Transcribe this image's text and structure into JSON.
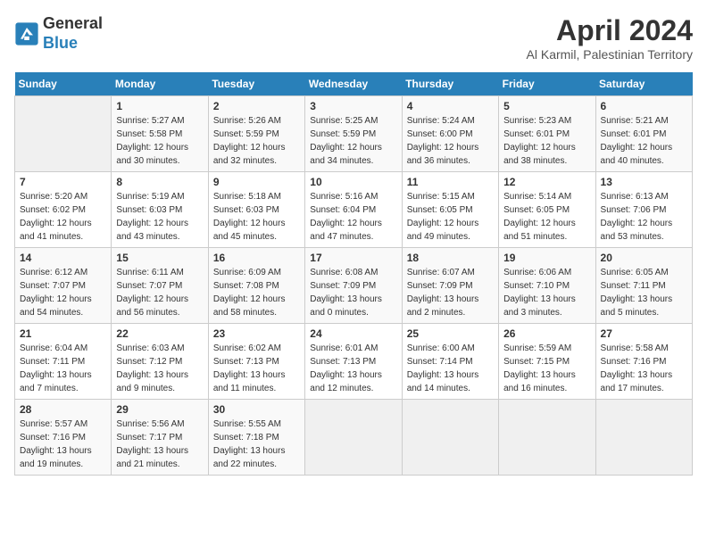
{
  "header": {
    "logo_line1": "General",
    "logo_line2": "Blue",
    "month": "April 2024",
    "location": "Al Karmil, Palestinian Territory"
  },
  "weekdays": [
    "Sunday",
    "Monday",
    "Tuesday",
    "Wednesday",
    "Thursday",
    "Friday",
    "Saturday"
  ],
  "weeks": [
    [
      {
        "day": "",
        "info": ""
      },
      {
        "day": "1",
        "info": "Sunrise: 5:27 AM\nSunset: 5:58 PM\nDaylight: 12 hours\nand 30 minutes."
      },
      {
        "day": "2",
        "info": "Sunrise: 5:26 AM\nSunset: 5:59 PM\nDaylight: 12 hours\nand 32 minutes."
      },
      {
        "day": "3",
        "info": "Sunrise: 5:25 AM\nSunset: 5:59 PM\nDaylight: 12 hours\nand 34 minutes."
      },
      {
        "day": "4",
        "info": "Sunrise: 5:24 AM\nSunset: 6:00 PM\nDaylight: 12 hours\nand 36 minutes."
      },
      {
        "day": "5",
        "info": "Sunrise: 5:23 AM\nSunset: 6:01 PM\nDaylight: 12 hours\nand 38 minutes."
      },
      {
        "day": "6",
        "info": "Sunrise: 5:21 AM\nSunset: 6:01 PM\nDaylight: 12 hours\nand 40 minutes."
      }
    ],
    [
      {
        "day": "7",
        "info": "Sunrise: 5:20 AM\nSunset: 6:02 PM\nDaylight: 12 hours\nand 41 minutes."
      },
      {
        "day": "8",
        "info": "Sunrise: 5:19 AM\nSunset: 6:03 PM\nDaylight: 12 hours\nand 43 minutes."
      },
      {
        "day": "9",
        "info": "Sunrise: 5:18 AM\nSunset: 6:03 PM\nDaylight: 12 hours\nand 45 minutes."
      },
      {
        "day": "10",
        "info": "Sunrise: 5:16 AM\nSunset: 6:04 PM\nDaylight: 12 hours\nand 47 minutes."
      },
      {
        "day": "11",
        "info": "Sunrise: 5:15 AM\nSunset: 6:05 PM\nDaylight: 12 hours\nand 49 minutes."
      },
      {
        "day": "12",
        "info": "Sunrise: 5:14 AM\nSunset: 6:05 PM\nDaylight: 12 hours\nand 51 minutes."
      },
      {
        "day": "13",
        "info": "Sunrise: 6:13 AM\nSunset: 7:06 PM\nDaylight: 12 hours\nand 53 minutes."
      }
    ],
    [
      {
        "day": "14",
        "info": "Sunrise: 6:12 AM\nSunset: 7:07 PM\nDaylight: 12 hours\nand 54 minutes."
      },
      {
        "day": "15",
        "info": "Sunrise: 6:11 AM\nSunset: 7:07 PM\nDaylight: 12 hours\nand 56 minutes."
      },
      {
        "day": "16",
        "info": "Sunrise: 6:09 AM\nSunset: 7:08 PM\nDaylight: 12 hours\nand 58 minutes."
      },
      {
        "day": "17",
        "info": "Sunrise: 6:08 AM\nSunset: 7:09 PM\nDaylight: 13 hours\nand 0 minutes."
      },
      {
        "day": "18",
        "info": "Sunrise: 6:07 AM\nSunset: 7:09 PM\nDaylight: 13 hours\nand 2 minutes."
      },
      {
        "day": "19",
        "info": "Sunrise: 6:06 AM\nSunset: 7:10 PM\nDaylight: 13 hours\nand 3 minutes."
      },
      {
        "day": "20",
        "info": "Sunrise: 6:05 AM\nSunset: 7:11 PM\nDaylight: 13 hours\nand 5 minutes."
      }
    ],
    [
      {
        "day": "21",
        "info": "Sunrise: 6:04 AM\nSunset: 7:11 PM\nDaylight: 13 hours\nand 7 minutes."
      },
      {
        "day": "22",
        "info": "Sunrise: 6:03 AM\nSunset: 7:12 PM\nDaylight: 13 hours\nand 9 minutes."
      },
      {
        "day": "23",
        "info": "Sunrise: 6:02 AM\nSunset: 7:13 PM\nDaylight: 13 hours\nand 11 minutes."
      },
      {
        "day": "24",
        "info": "Sunrise: 6:01 AM\nSunset: 7:13 PM\nDaylight: 13 hours\nand 12 minutes."
      },
      {
        "day": "25",
        "info": "Sunrise: 6:00 AM\nSunset: 7:14 PM\nDaylight: 13 hours\nand 14 minutes."
      },
      {
        "day": "26",
        "info": "Sunrise: 5:59 AM\nSunset: 7:15 PM\nDaylight: 13 hours\nand 16 minutes."
      },
      {
        "day": "27",
        "info": "Sunrise: 5:58 AM\nSunset: 7:16 PM\nDaylight: 13 hours\nand 17 minutes."
      }
    ],
    [
      {
        "day": "28",
        "info": "Sunrise: 5:57 AM\nSunset: 7:16 PM\nDaylight: 13 hours\nand 19 minutes."
      },
      {
        "day": "29",
        "info": "Sunrise: 5:56 AM\nSunset: 7:17 PM\nDaylight: 13 hours\nand 21 minutes."
      },
      {
        "day": "30",
        "info": "Sunrise: 5:55 AM\nSunset: 7:18 PM\nDaylight: 13 hours\nand 22 minutes."
      },
      {
        "day": "",
        "info": ""
      },
      {
        "day": "",
        "info": ""
      },
      {
        "day": "",
        "info": ""
      },
      {
        "day": "",
        "info": ""
      }
    ]
  ]
}
